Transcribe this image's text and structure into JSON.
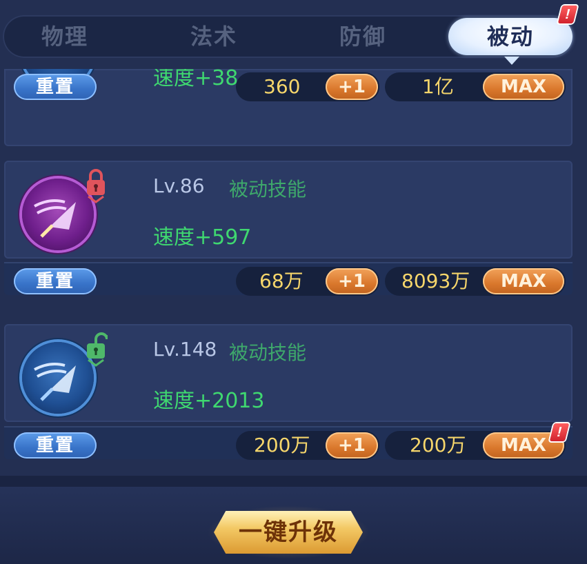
{
  "tabs": [
    {
      "label": "物理",
      "active": false
    },
    {
      "label": "法术",
      "active": false
    },
    {
      "label": "防御",
      "active": false
    },
    {
      "label": "被动",
      "active": true
    }
  ],
  "alert_badge": "!",
  "partial_card": {
    "stat_fragment": "速度+38",
    "reset_label": "重置",
    "cost_single": "360",
    "plus_label": "+1",
    "cost_max": "1亿",
    "max_label": "MAX"
  },
  "cards": [
    {
      "level": "Lv.86",
      "type": "被动技能",
      "stat": "速度+597",
      "lock_state": "locked",
      "lock_color": "#e0545c",
      "icon_color": "purple",
      "reset_label": "重置",
      "cost_single": "68万",
      "plus_label": "+1",
      "cost_max": "8093万",
      "max_label": "MAX"
    },
    {
      "level": "Lv.148",
      "type": "被动技能",
      "stat": "速度+2013",
      "lock_state": "unlocked",
      "lock_color": "#4fb86a",
      "icon_color": "blue",
      "reset_label": "重置",
      "cost_single": "200万",
      "plus_label": "+1",
      "cost_max": "200万",
      "max_label": "MAX"
    }
  ],
  "upgrade_all_label": "一键升级",
  "colors": {
    "background": "#232f52",
    "card": "#2b3a64",
    "gold_text": "#f6d66b",
    "green_text": "#3fd870",
    "orange_button": "#d9772c",
    "blue_button": "#3873c8"
  }
}
